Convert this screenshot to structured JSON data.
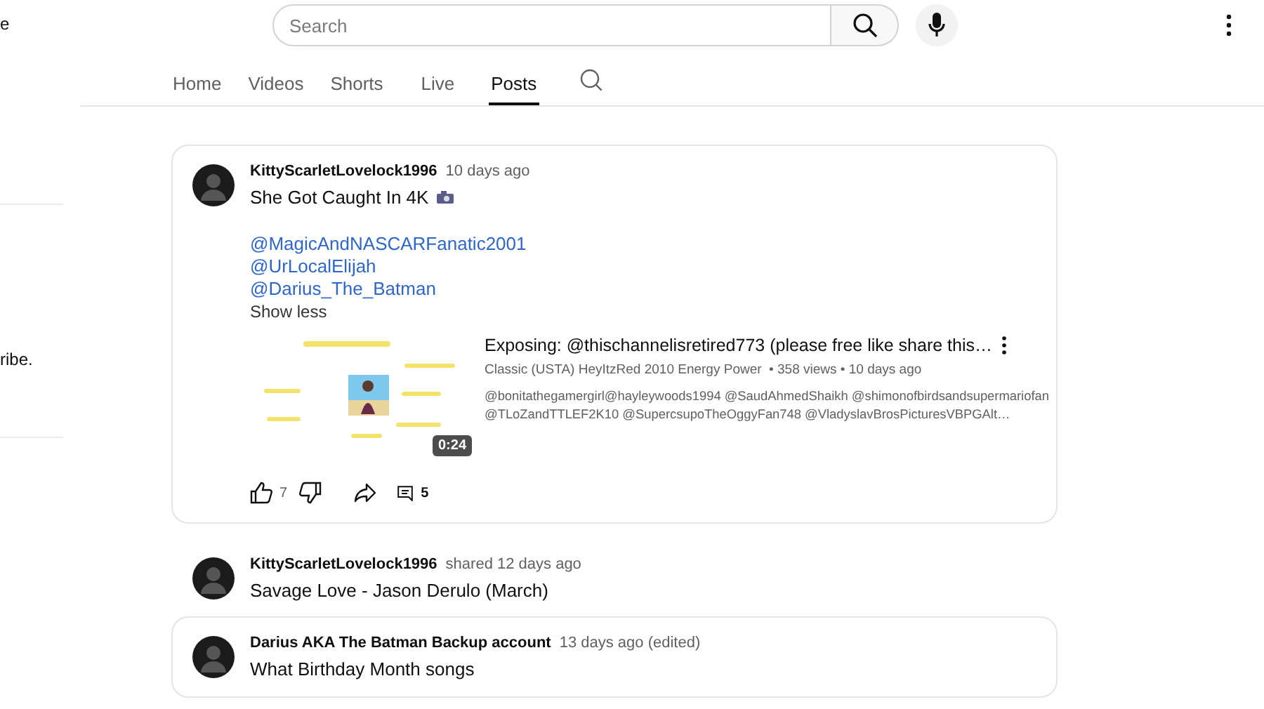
{
  "sidebar_fragments": [
    {
      "text": "e"
    },
    {
      "text": "ribe."
    }
  ],
  "search": {
    "placeholder": "Search"
  },
  "tabs": [
    {
      "label": "Home",
      "selected": false
    },
    {
      "label": "Videos",
      "selected": false
    },
    {
      "label": "Shorts",
      "selected": false
    },
    {
      "label": "Live",
      "selected": false
    },
    {
      "label": "Posts",
      "selected": true
    }
  ],
  "posts": [
    {
      "framed": true,
      "author": "KittyScarletLovelock1996",
      "time": "10 days ago",
      "title": "She Got Caught In 4K",
      "mentions": [
        "@MagicAndNASCARFanatic2001",
        "@UrLocalElijah",
        "@Darius_The_Batman"
      ],
      "toggle": "Show less",
      "video": {
        "duration": "0:24",
        "title": "Exposing: @thischannelisretired773 (please free like share this…",
        "meta": "Classic (USTA) HeyItzRed 2010 Energy Power  • 358 views • 10 days ago",
        "description": [
          "@bonitathegamergirl@hayleywoods1994 @SaudAhmedShaikh @shimonofbirdsandsupermariofan",
          "@TLoZandTTLEF2K10 @SupercsupoTheOggyFan748 @VladyslavBrosPicturesVBPGAlt…"
        ]
      },
      "likes": "7",
      "comments": "5"
    },
    {
      "framed": false,
      "author": "KittyScarletLovelock1996",
      "time": "shared 12 days ago",
      "title": "Savage Love - Jason Derulo (March)"
    },
    {
      "framed": true,
      "author": "Darius AKA The Batman Backup account",
      "time": "13 days ago (edited)",
      "title": "What Birthday Month songs"
    }
  ]
}
